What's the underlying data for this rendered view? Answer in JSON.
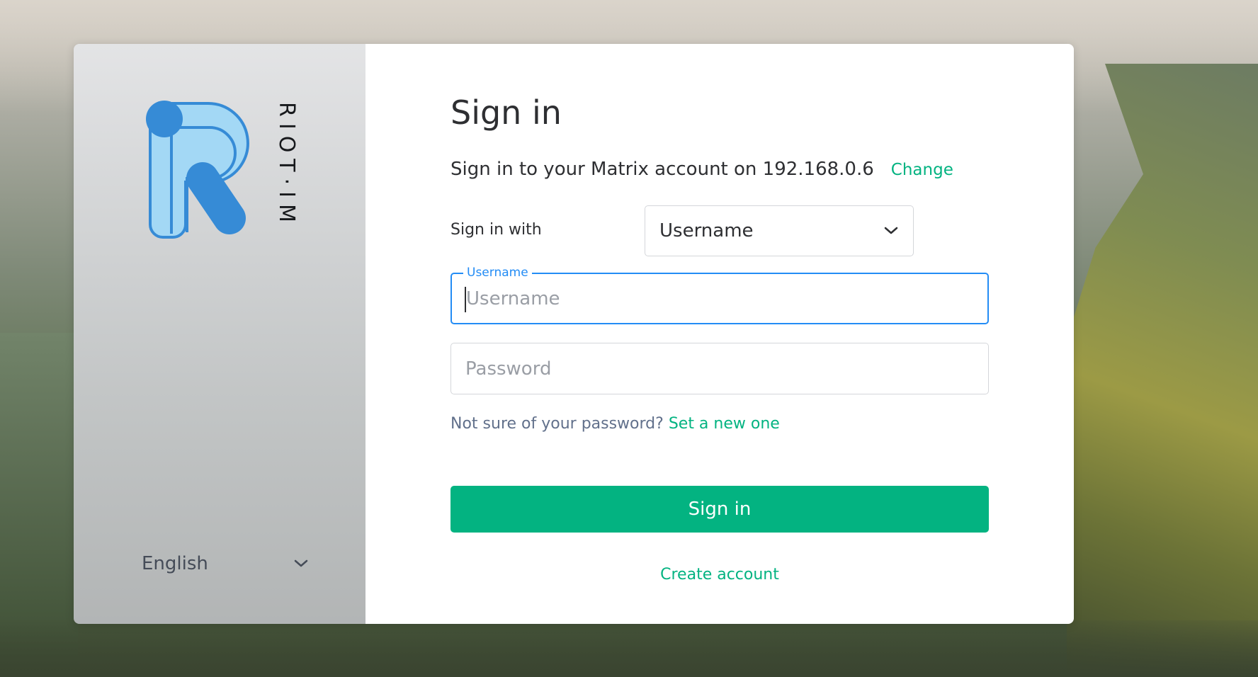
{
  "branding": {
    "wordmark": "RIOT·IM",
    "logo_icon": "riot-r-logo-icon",
    "colors": {
      "logo_fill": "#a3d8f5",
      "logo_accent": "#368bd6",
      "accent": "#03b381",
      "focus": "#238cf5"
    }
  },
  "language": {
    "selected": "English",
    "icon": "chevron-down-icon"
  },
  "signin": {
    "title": "Sign in",
    "server_text": "Sign in to your Matrix account on 192.168.0.6",
    "change_link": "Change",
    "signin_with_label": "Sign in with",
    "method_select": {
      "selected": "Username",
      "icon": "chevron-down-icon"
    },
    "username_field": {
      "legend": "Username",
      "placeholder": "Username",
      "value": ""
    },
    "password_field": {
      "placeholder": "Password"
    },
    "forgot_text": "Not sure of your password?",
    "forgot_link": "Set a new one",
    "submit_label": "Sign in",
    "create_account": "Create account"
  }
}
